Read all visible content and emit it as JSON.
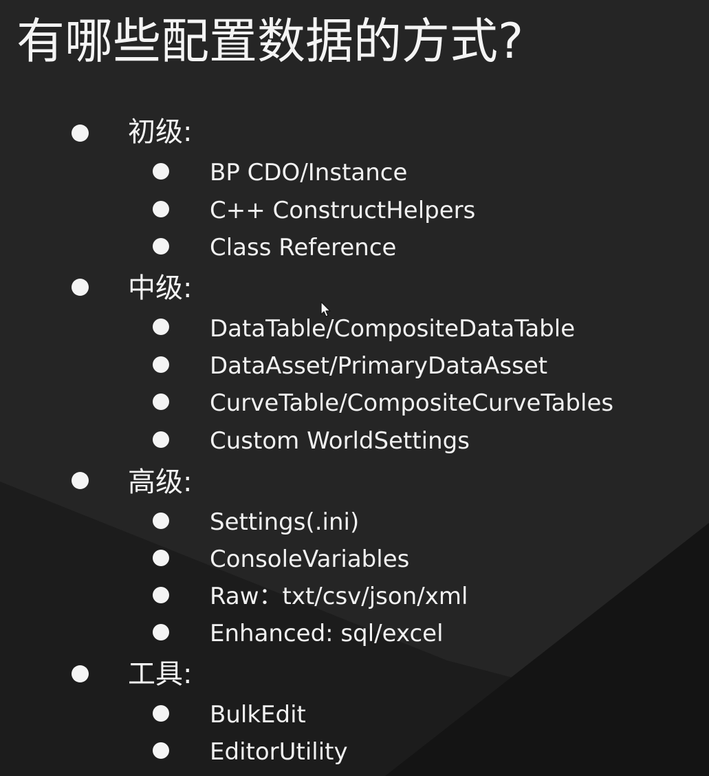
{
  "title": "有哪些配置数据的方式?",
  "sections": [
    {
      "label": "初级:",
      "items": [
        "BP CDO/Instance",
        "C++ ConstructHelpers",
        "Class Reference"
      ]
    },
    {
      "label": "中级:",
      "items": [
        "DataTable/CompositeDataTable",
        "DataAsset/PrimaryDataAsset",
        "CurveTable/CompositeCurveTables",
        "Custom WorldSettings"
      ]
    },
    {
      "label": "高级:",
      "items": [
        "Settings(.ini)",
        "ConsoleVariables",
        "Raw：txt/csv/json/xml",
        "Enhanced: sql/excel"
      ]
    },
    {
      "label": "工具:",
      "items": [
        "BulkEdit",
        "EditorUtility"
      ]
    }
  ],
  "colors": {
    "background": "#242424",
    "background_lower": "#1c1c1c",
    "background_corner": "#141414",
    "text": "#f4f4f4"
  },
  "icons": {
    "bullet": "filled-circle",
    "cursor": "mouse-pointer-arrow"
  }
}
